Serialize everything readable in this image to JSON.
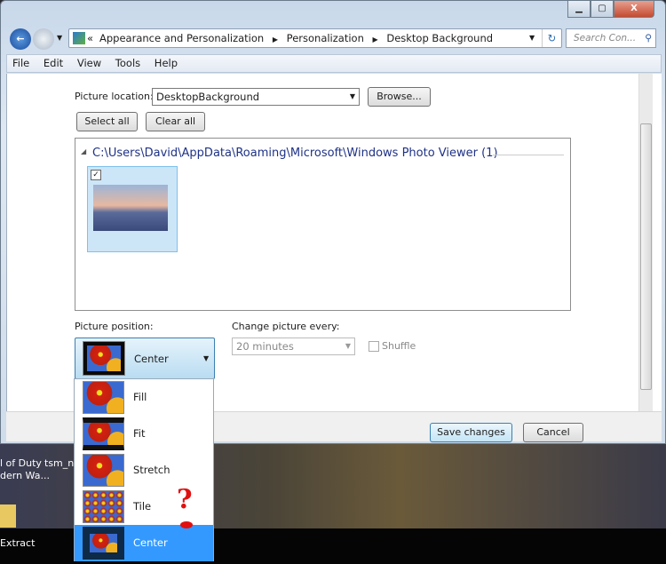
{
  "window": {
    "controls": [
      "minimize",
      "maximize",
      "close"
    ]
  },
  "address_bar": {
    "overflow": "«",
    "crumbs": [
      "Appearance and Personalization",
      "Personalization",
      "Desktop Background"
    ]
  },
  "search": {
    "placeholder": "Search Con..."
  },
  "menu": [
    "File",
    "Edit",
    "View",
    "Tools",
    "Help"
  ],
  "picture_location": {
    "label": "Picture location:",
    "value": "DesktopBackground",
    "browse": "Browse..."
  },
  "buttons": {
    "select_all": "Select all",
    "clear_all": "Clear all",
    "save": "Save changes",
    "cancel": "Cancel"
  },
  "gallery": {
    "group": "C:\\Users\\David\\AppData\\Roaming\\Microsoft\\Windows Photo Viewer (1)",
    "items": [
      {
        "checked": true
      }
    ]
  },
  "position": {
    "label": "Picture position:",
    "value": "Center",
    "options": [
      "Fill",
      "Fit",
      "Stretch",
      "Tile",
      "Center"
    ],
    "selected": "Center"
  },
  "interval": {
    "label": "Change picture every:",
    "value": "20 minutes",
    "shuffle": "Shuffle",
    "shuffle_checked": false
  },
  "annotation": "?",
  "desktop": {
    "icon1": "l of Duty",
    "icon1b": "dern Wa...",
    "icon2": "tsm_ne",
    "icon3": "Extract"
  },
  "colors": {
    "selection": "#3399ff",
    "link": "#1e3287"
  }
}
